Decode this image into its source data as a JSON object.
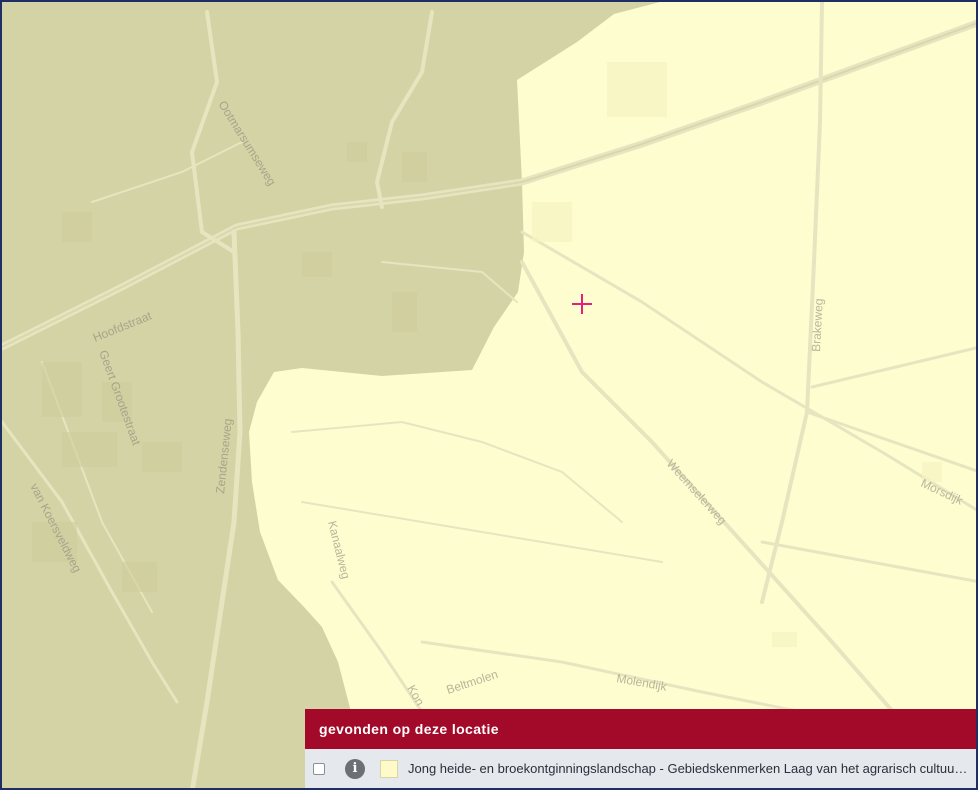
{
  "map": {
    "colors": {
      "outer_zone": "#d4d3a5",
      "inner_zone": "#fefdd0",
      "road": "#e7e5bf",
      "crosshair": "#e4207f"
    },
    "marker_icon": "crosshair-icon",
    "street_labels": [
      "Ootmarsumseweg",
      "Hoofdstraat",
      "Geert Grootestraat",
      "Zendenseweg",
      "van Koersveldweg",
      "Kanaalweg",
      "Beltmolen",
      "Molendijk",
      "Kon",
      "Weemselerweg",
      "Brakeweg",
      "Morsdijk"
    ]
  },
  "panel": {
    "title": "gevonden op deze locatie",
    "results": [
      {
        "checked": false,
        "info_icon": "info-icon",
        "swatch_color": "#fefbc8",
        "label": "Jong heide- en broekontginningslandschap - Gebiedskenmerken Laag van het agrarisch cultuurlandschap"
      }
    ]
  }
}
